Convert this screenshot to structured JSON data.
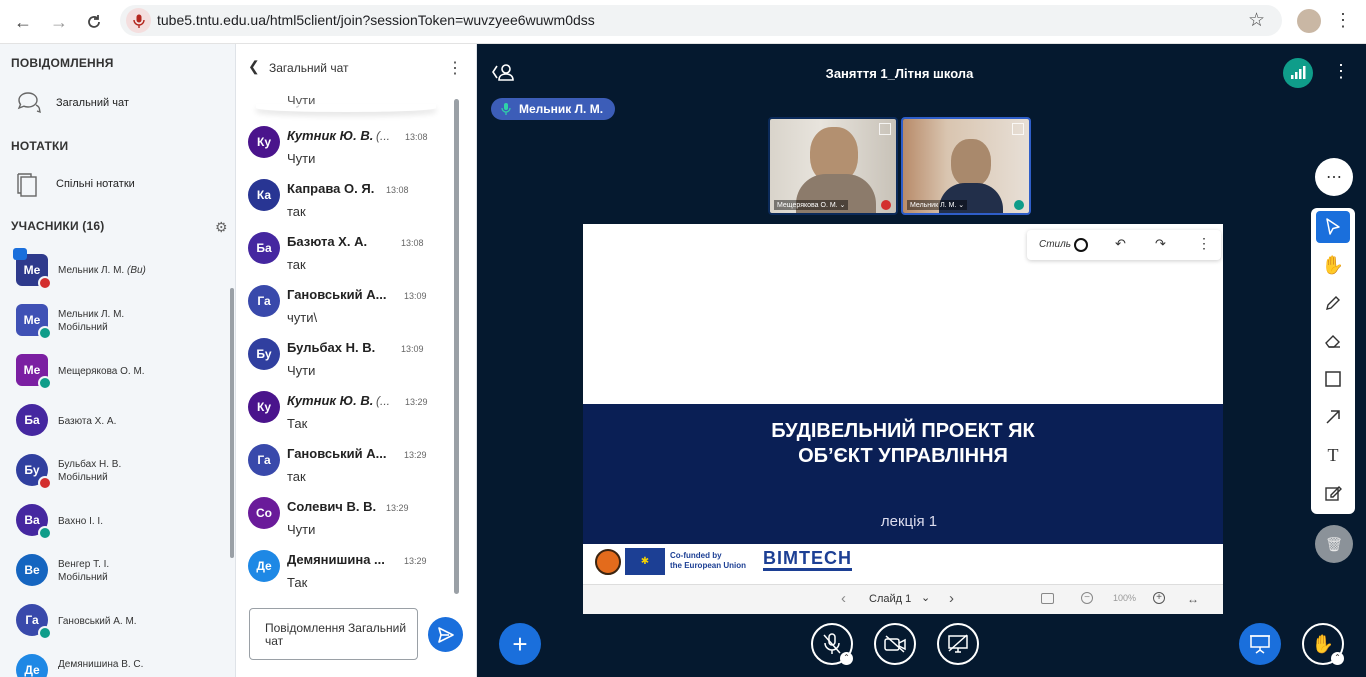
{
  "browser": {
    "url": "tube5.tntu.edu.ua/html5client/join?sessionToken=wuvzyee6wuwm0dss"
  },
  "sidebar": {
    "messages_title": "ПОВІДОМЛЕННЯ",
    "public_chat_label": "Загальний чат",
    "notes_title": "НОТАТКИ",
    "shared_notes_label": "Спільні нотатки",
    "participants_title": "УЧАСНИКИ (16)",
    "users": [
      {
        "initials": "Ме",
        "name": "Мельник Л. М.",
        "suffix": "(Ви)",
        "sub": "",
        "color": "#2e3a8c"
      },
      {
        "initials": "Ме",
        "name": "Мельник Л. М.",
        "suffix": "",
        "sub": "Мобільний",
        "color": "#3f51b5"
      },
      {
        "initials": "Ме",
        "name": "Мещерякова О. М.",
        "suffix": "",
        "sub": "",
        "color": "#7b1fa2"
      },
      {
        "initials": "Ба",
        "name": "Базюта Х. А.",
        "suffix": "",
        "sub": "",
        "color": "#4527a0"
      },
      {
        "initials": "Бу",
        "name": "Бульбах Н. В.",
        "suffix": "",
        "sub": "Мобільний",
        "color": "#303f9f"
      },
      {
        "initials": "Ва",
        "name": "Вахно І. І.",
        "suffix": "",
        "sub": "",
        "color": "#4527a0"
      },
      {
        "initials": "Ве",
        "name": "Венгер Т. І.",
        "suffix": "",
        "sub": "Мобільний",
        "color": "#1565c0"
      },
      {
        "initials": "Га",
        "name": "Гановський А. М.",
        "suffix": "",
        "sub": "",
        "color": "#3949ab"
      },
      {
        "initials": "Де",
        "name": "Демянишина В. С.",
        "suffix": "",
        "sub": "",
        "color": "#1e88e5"
      }
    ]
  },
  "chat": {
    "header_title": "Загальний чат",
    "partial_text": "Чути",
    "messages": [
      {
        "initials": "Ку",
        "sender": "Кутник Ю. В.",
        "sender_extra": "(...",
        "time": "13:08",
        "text": "Чути",
        "color": "#4a148c",
        "italic": true
      },
      {
        "initials": "Ка",
        "sender": "Каправа О. Я.",
        "sender_extra": "",
        "time": "13:08",
        "text": "так",
        "color": "#283593",
        "italic": false
      },
      {
        "initials": "Ба",
        "sender": "Базюта Х. А.",
        "sender_extra": "",
        "time": "13:08",
        "text": "так",
        "color": "#4527a0",
        "italic": false
      },
      {
        "initials": "Га",
        "sender": "Гановський А...",
        "sender_extra": "",
        "time": "13:09",
        "text": "чути\\",
        "color": "#3949ab",
        "italic": false
      },
      {
        "initials": "Бу",
        "sender": "Бульбах Н. В.",
        "sender_extra": "",
        "time": "13:09",
        "text": "Чути",
        "color": "#303f9f",
        "italic": false
      },
      {
        "initials": "Ку",
        "sender": "Кутник Ю. В.",
        "sender_extra": "(...",
        "time": "13:29",
        "text": "Так",
        "color": "#4a148c",
        "italic": true
      },
      {
        "initials": "Га",
        "sender": "Гановський А...",
        "sender_extra": "",
        "time": "13:29",
        "text": "так",
        "color": "#3949ab",
        "italic": false
      },
      {
        "initials": "Со",
        "sender": "Солевич В. В.",
        "sender_extra": "",
        "time": "13:29",
        "text": "Чути",
        "color": "#6a1b9a",
        "italic": false
      },
      {
        "initials": "Де",
        "sender": "Демянишина ...",
        "sender_extra": "",
        "time": "13:29",
        "text": "Так",
        "color": "#1e88e5",
        "italic": false
      }
    ],
    "input_placeholder": "Повідомлення Загальний чат"
  },
  "meeting": {
    "title": "Заняття 1_Літня школа",
    "talking": "Мельник Л. М.",
    "video_tiles": [
      {
        "name": "Мещерякова О. М. ⌄"
      },
      {
        "name": "Мельник Л. М. ⌄"
      }
    ]
  },
  "presentation": {
    "toolbar_style_label": "Стиль",
    "title_line1": "БУДІВЕЛЬНИЙ ПРОЕКТ ЯК",
    "title_line2": "ОБ’ЄКТ УПРАВЛІННЯ",
    "subtitle": "лекція 1",
    "cofunded_line1": "Co-funded by",
    "cofunded_line2": "the European Union",
    "brand": "BIMTECH",
    "slide_label": "Слайд 1",
    "zoom": "100%"
  },
  "colors": {
    "accent": "#1a6fdc",
    "main_bg": "#05192f",
    "slide_band": "#0a1f55",
    "connection": "#0f9d8a"
  }
}
